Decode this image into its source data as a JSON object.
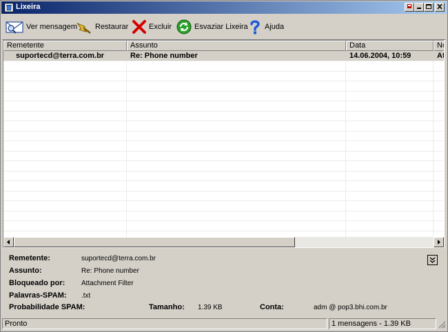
{
  "window": {
    "title": "Lixeira"
  },
  "toolbar": {
    "view": "Ver mensagem",
    "restore": "Restaurar",
    "delete": "Excluir",
    "empty": "Esvaziar Lixeira",
    "help": "Ajuda"
  },
  "list": {
    "columns": [
      "Remetente",
      "Assunto",
      "Data",
      "No"
    ],
    "rows": [
      {
        "sender": "suportecd@terra.com.br",
        "subject": "Re: Phone number",
        "date": "14.06.2004, 10:59",
        "extra": "At"
      }
    ]
  },
  "details": {
    "sender_label": "Remetente:",
    "sender_value": "suportecd@terra.com.br",
    "subject_label": "Assunto:",
    "subject_value": "Re: Phone number",
    "blocked_label": "Bloqueado por:",
    "blocked_value": "Attachment Filter",
    "spamwords_label": "Palavras-SPAM:",
    "spamwords_value": ".txt",
    "prob_label": "Probabilidade SPAM:",
    "size_label": "Tamanho:",
    "size_value": "1.39 KB",
    "account_label": "Conta:",
    "account_value": "adm @ pop3.bhi.com.br"
  },
  "status": {
    "left": "Pronto",
    "right": "1 mensagens - 1.39 KB"
  },
  "colors": {
    "titlebar_start": "#0a246a",
    "titlebar_end": "#a6caf0",
    "face": "#d4d0c8"
  }
}
